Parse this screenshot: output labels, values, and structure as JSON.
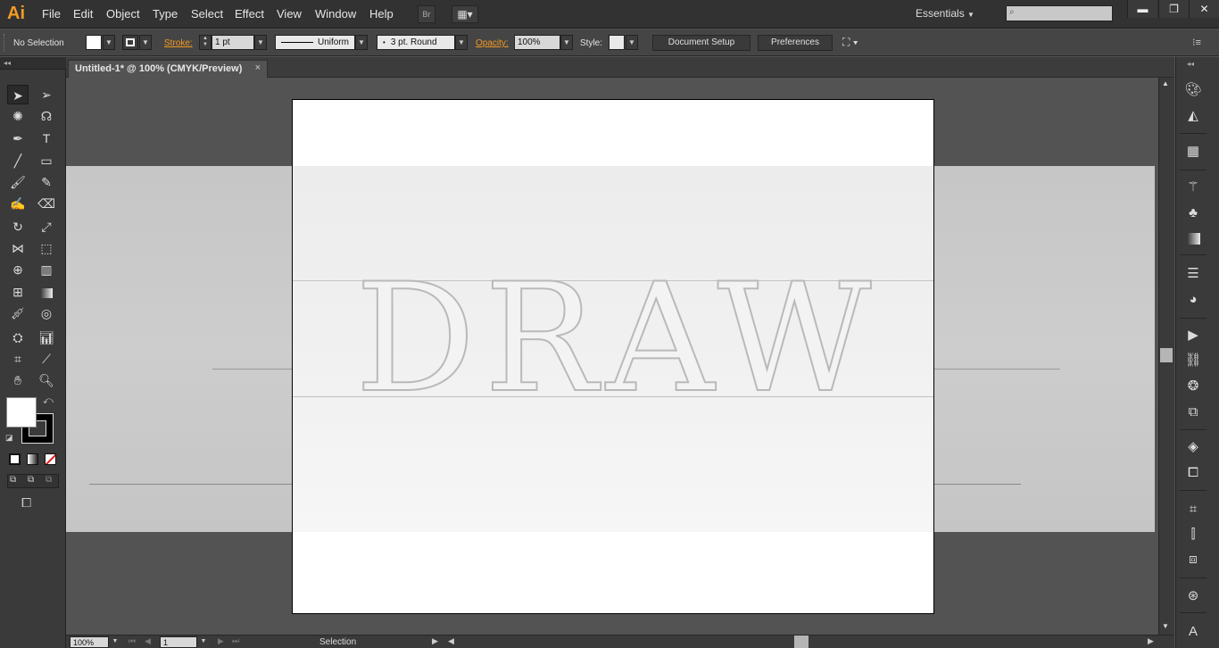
{
  "app": {
    "logo": "Ai",
    "menu": [
      "File",
      "Edit",
      "Object",
      "Type",
      "Select",
      "Effect",
      "View",
      "Window",
      "Help"
    ],
    "bridge_label": "Br",
    "workspace": "Essentials",
    "window_controls": [
      "minimize-icon",
      "restore-icon",
      "close-icon"
    ]
  },
  "control_bar": {
    "selection_status": "No Selection",
    "stroke_label": "Stroke:",
    "stroke_weight": "1 pt",
    "stroke_profile": "Uniform",
    "brush": "3 pt. Round",
    "opacity_label": "Opacity:",
    "opacity_value": "100%",
    "style_label": "Style:",
    "document_setup": "Document Setup",
    "preferences": "Preferences"
  },
  "document": {
    "tab_title": "Untitled-1* @ 100% (CMYK/Preview)",
    "tab_close": "×",
    "artwork_text": "DRAW"
  },
  "status_bar": {
    "zoom": "100%",
    "artboard_number": "1",
    "tool_status": "Selection"
  },
  "tools": [
    "selection-tool-icon",
    "direct-selection-tool-icon",
    "magic-wand-icon",
    "lasso-icon",
    "pen-tool-icon",
    "type-tool-icon",
    "line-tool-icon",
    "rectangle-tool-icon",
    "paintbrush-icon",
    "pencil-icon",
    "blob-brush-icon",
    "eraser-icon",
    "rotate-tool-icon",
    "scale-tool-icon",
    "width-tool-icon",
    "free-transform-icon",
    "shape-builder-icon",
    "perspective-grid-icon",
    "mesh-tool-icon",
    "gradient-tool-icon",
    "eyedropper-icon",
    "blend-tool-icon",
    "symbol-sprayer-icon",
    "column-graph-icon",
    "artboard-tool-icon",
    "slice-tool-icon",
    "hand-tool-icon",
    "zoom-tool-icon"
  ],
  "right_panel_icons": [
    "color-icon",
    "color-guide-icon",
    "swatches-icon",
    "brushes-icon",
    "symbols-icon",
    "gradient-icon",
    "stroke-icon",
    "transparency-icon",
    "actions-icon",
    "links-icon",
    "appearance-icon",
    "graphic-styles-icon",
    "layers-icon",
    "artboards-icon",
    "transform-icon",
    "align-icon",
    "pathfinder-icon",
    "navigator-icon",
    "character-icon"
  ],
  "colors": {
    "accent": "#f39a23",
    "fill": "#ffffff",
    "stroke": "#000000"
  }
}
